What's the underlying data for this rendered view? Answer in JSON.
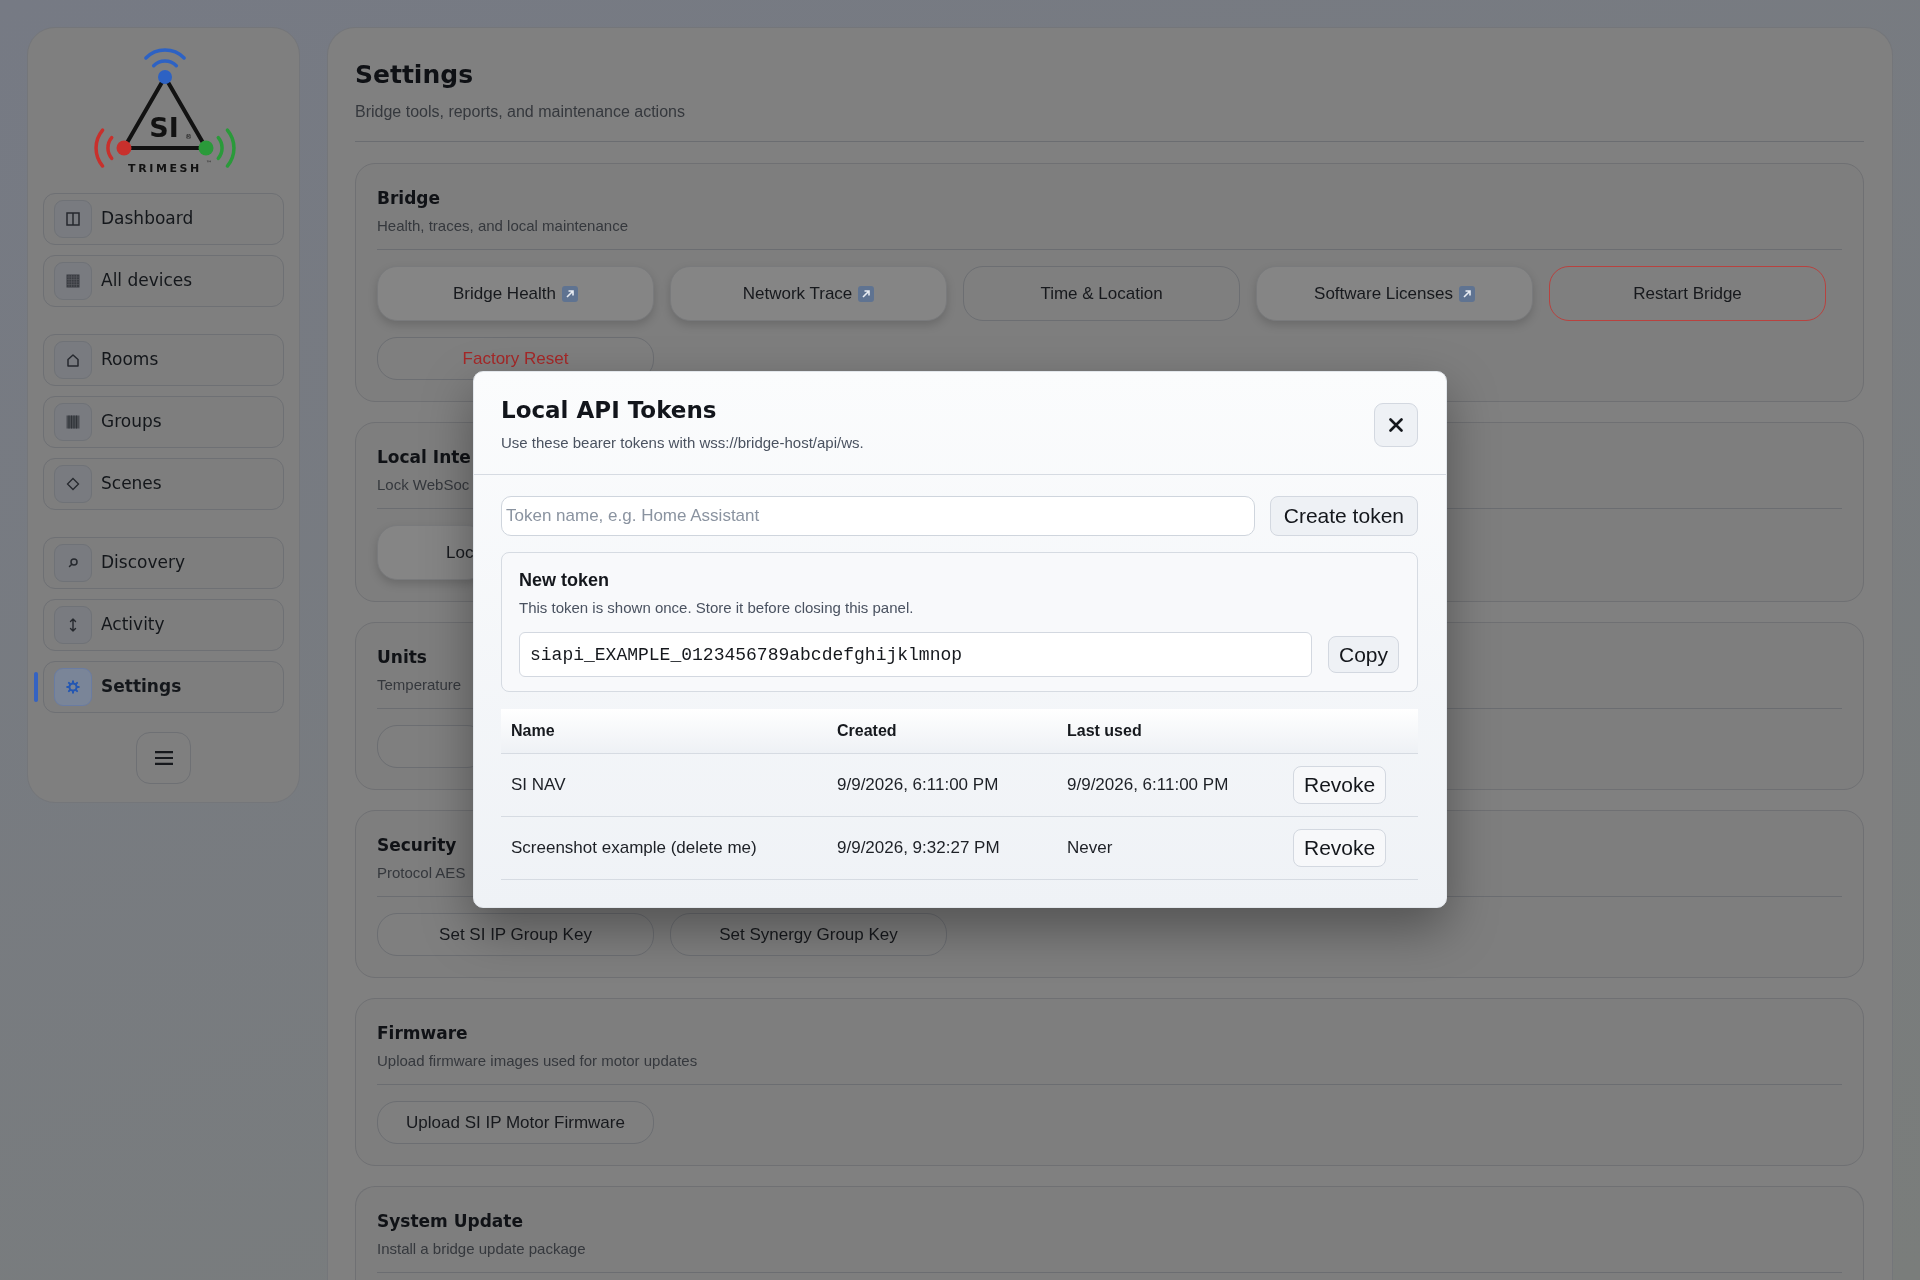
{
  "sidebar": {
    "logo": {
      "mark": "SI",
      "registered": "®",
      "wordmark": "TRIMESH",
      "trademark": "™"
    },
    "nav_groups": [
      [
        {
          "label": "Dashboard",
          "selected": false
        },
        {
          "label": "All devices",
          "selected": false
        }
      ],
      [
        {
          "label": "Rooms",
          "selected": false
        },
        {
          "label": "Groups",
          "selected": false
        },
        {
          "label": "Scenes",
          "selected": false
        }
      ],
      [
        {
          "label": "Discovery",
          "selected": false
        },
        {
          "label": "Activity",
          "selected": false
        },
        {
          "label": "Settings",
          "selected": true
        }
      ]
    ]
  },
  "page": {
    "title": "Settings",
    "subtitle": "Bridge tools, reports, and maintenance actions"
  },
  "sections": [
    {
      "title": "Bridge",
      "subtitle": "Health, traces, and local maintenance",
      "buttons": [
        {
          "label": "Bridge Health",
          "kind": "panel",
          "external": true,
          "covered": false
        },
        {
          "label": "Network Trace",
          "kind": "panel",
          "external": true,
          "covered": false
        },
        {
          "label": "Time & Location",
          "kind": "plain",
          "external": false,
          "covered": false
        },
        {
          "label": "Software Licenses",
          "kind": "panel",
          "external": true,
          "covered": false
        },
        {
          "label": "Restart Bridge",
          "kind": "warning",
          "external": false,
          "covered": false
        },
        {
          "label": "Factory Reset",
          "kind": "danger",
          "external": false,
          "covered": false
        }
      ]
    },
    {
      "title": "Local Inte",
      "subtitle": "Lock WebSoc",
      "buttons": [
        {
          "label": "Loc",
          "kind": "panel",
          "external": false,
          "covered": true
        }
      ]
    },
    {
      "title": "Units",
      "subtitle": "Temperature",
      "buttons": [
        {
          "kind": "plain",
          "external": false,
          "covered": true
        }
      ]
    },
    {
      "title": "Security",
      "subtitle": "Protocol AES",
      "buttons": [
        {
          "label": "Set SI IP Group Key",
          "kind": "plain",
          "external": false,
          "covered": false
        },
        {
          "label": "Set Synergy Group Key",
          "kind": "plain",
          "external": false,
          "covered": false
        }
      ]
    },
    {
      "title": "Firmware",
      "subtitle": "Upload firmware images used for motor updates",
      "buttons": [
        {
          "label": "Upload SI IP Motor Firmware",
          "kind": "plain",
          "external": false,
          "covered": false
        }
      ]
    },
    {
      "title": "System Update",
      "subtitle": "Install a bridge update package"
    }
  ],
  "modal": {
    "title": "Local API Tokens",
    "subtitle": "Use these bearer tokens with wss://bridge-host/api/ws.",
    "name_field": {
      "placeholder": "Token name, e.g. Home Assistant"
    },
    "create_button": "Create token",
    "new_token": {
      "title": "New token",
      "note": "This token is shown once. Store it before closing this panel.",
      "value": "siapi_EXAMPLE_0123456789abcdefghijklmnop",
      "copy_button": "Copy"
    },
    "table": {
      "columns": [
        "Name",
        "Created",
        "Last used"
      ],
      "rows": [
        {
          "cells": [
            "SI NAV",
            "9/9/2026, 6:11:00 PM",
            "9/9/2026, 6:11:00 PM"
          ],
          "action": "Revoke"
        },
        {
          "cells": [
            "Screenshot example (delete me)",
            "9/9/2026, 9:32:27 PM",
            "Never"
          ],
          "action": "Revoke"
        }
      ]
    }
  }
}
